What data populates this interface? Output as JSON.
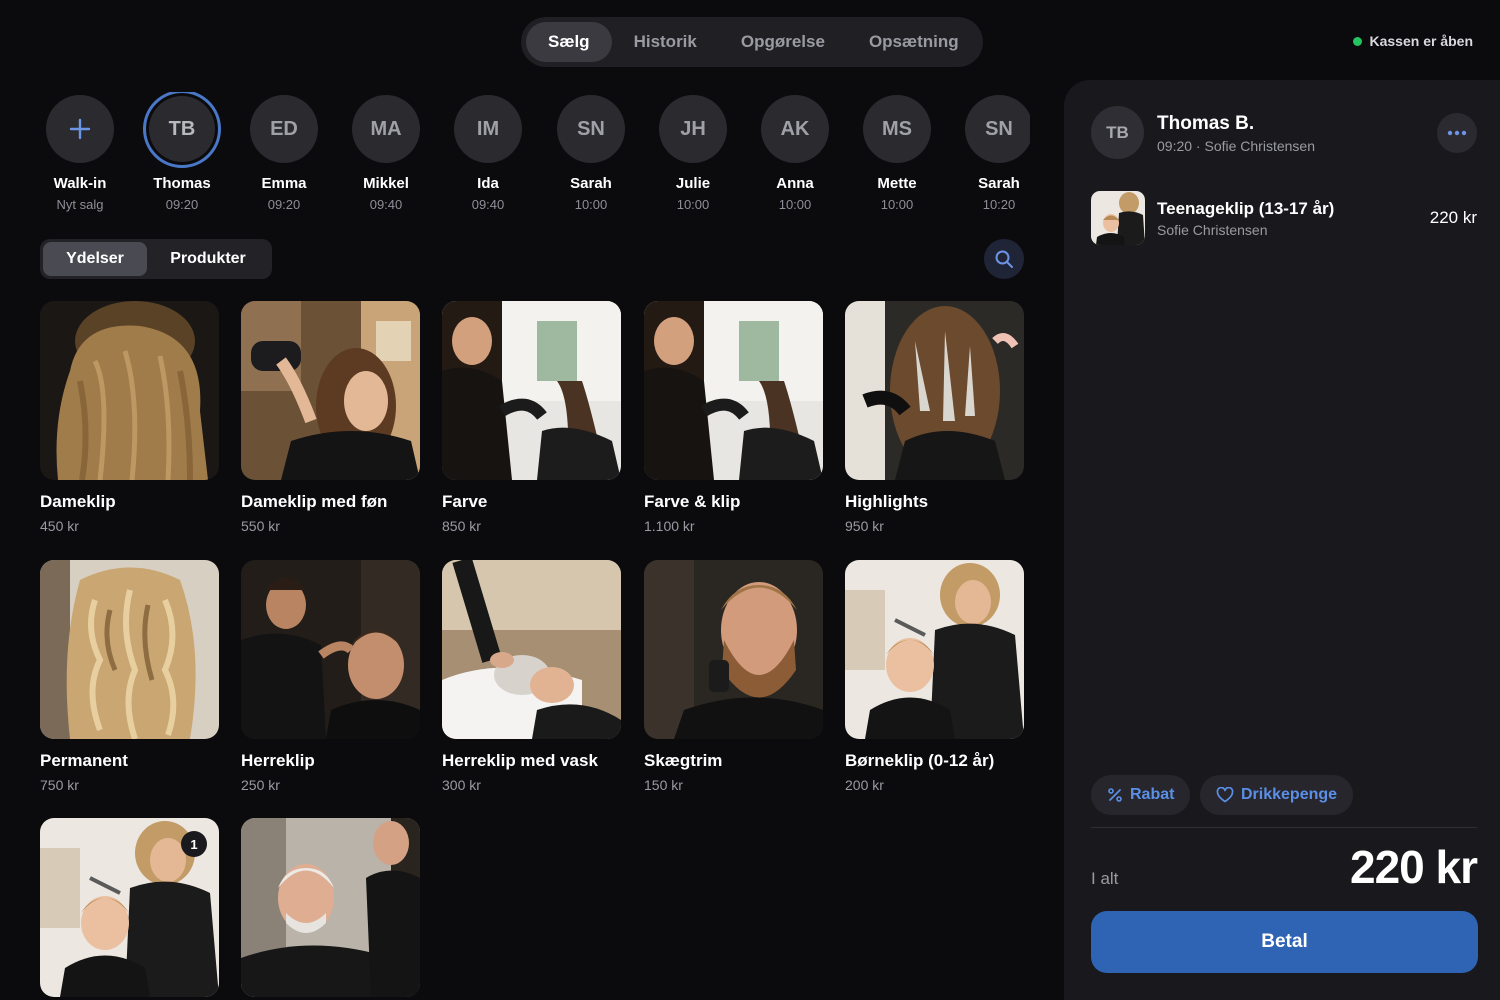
{
  "nav": {
    "tabs": [
      "Sælg",
      "Historik",
      "Opgørelse",
      "Opsætning"
    ],
    "active": "Sælg"
  },
  "status": {
    "label": "Kassen er åben",
    "color": "#22c55e"
  },
  "customers": [
    {
      "initials": "+",
      "name": "Walk-in",
      "sub": "Nyt salg"
    },
    {
      "initials": "TB",
      "name": "Thomas",
      "sub": "09:20",
      "active": true
    },
    {
      "initials": "ED",
      "name": "Emma",
      "sub": "09:20"
    },
    {
      "initials": "MA",
      "name": "Mikkel",
      "sub": "09:40"
    },
    {
      "initials": "IM",
      "name": "Ida",
      "sub": "09:40"
    },
    {
      "initials": "SN",
      "name": "Sarah",
      "sub": "10:00"
    },
    {
      "initials": "JH",
      "name": "Julie",
      "sub": "10:00"
    },
    {
      "initials": "AK",
      "name": "Anna",
      "sub": "10:00"
    },
    {
      "initials": "MS",
      "name": "Mette",
      "sub": "10:00"
    },
    {
      "initials": "SN",
      "name": "Sarah",
      "sub": "10:20"
    }
  ],
  "segment": {
    "services": "Ydelser",
    "products": "Produkter"
  },
  "services": [
    {
      "title": "Dameklip",
      "price": "450 kr",
      "image": "blonde-hair-back-photo"
    },
    {
      "title": "Dameklip med føn",
      "price": "550 kr",
      "image": "blowdry-photo"
    },
    {
      "title": "Farve",
      "price": "850 kr",
      "image": "coloring-photo"
    },
    {
      "title": "Farve & klip",
      "price": "1.100 kr",
      "image": "coloring-photo"
    },
    {
      "title": "Highlights",
      "price": "950 kr",
      "image": "highlights-foil-photo"
    },
    {
      "title": "Permanent",
      "price": "750 kr",
      "image": "wavy-hair-photo"
    },
    {
      "title": "Herreklip",
      "price": "250 kr",
      "image": "barber-photo"
    },
    {
      "title": "Herreklip med vask",
      "price": "300 kr",
      "image": "hair-wash-photo"
    },
    {
      "title": "Skægtrim",
      "price": "150 kr",
      "image": "beard-trim-photo"
    },
    {
      "title": "Børneklip (0-12 år)",
      "price": "200 kr",
      "image": "kid-haircut-photo"
    },
    {
      "title": "",
      "price": "",
      "image": "kid-haircut-photo",
      "badge": "1"
    },
    {
      "title": "",
      "price": "",
      "image": "senior-haircut-photo"
    }
  ],
  "order": {
    "initials": "TB",
    "customer": "Thomas B.",
    "meta": "09:20 · Sofie Christensen",
    "items": [
      {
        "title": "Teenageklip (13-17 år)",
        "staff": "Sofie Christensen",
        "price": "220 kr"
      }
    ],
    "discount": "Rabat",
    "tip": "Drikkepenge",
    "total_label": "I alt",
    "total": "220 kr",
    "pay": "Betal"
  },
  "colors": {
    "accent": "#2f63b3",
    "link": "#5b8fe6",
    "background": "#0b0b0e",
    "panel": "#19191d"
  }
}
